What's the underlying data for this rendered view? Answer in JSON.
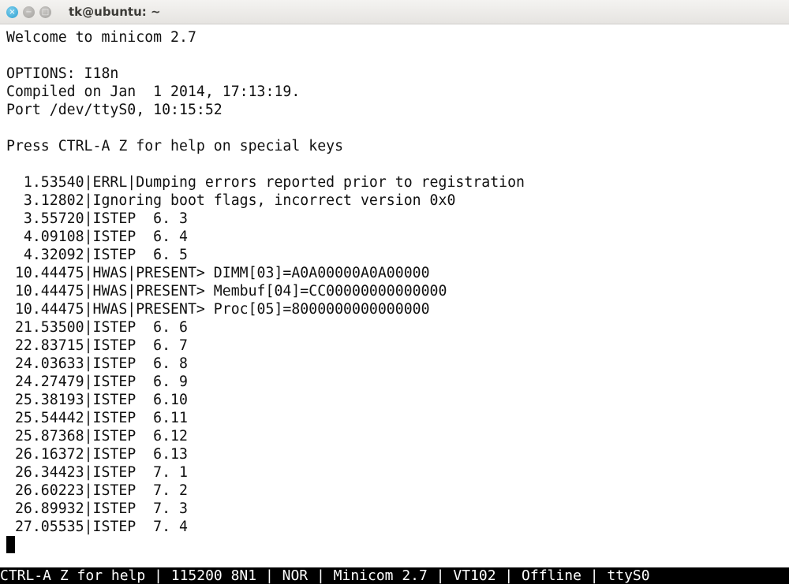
{
  "window": {
    "title": "tk@ubuntu: ~",
    "close_icon": "×",
    "minimize_icon": "−",
    "maximize_icon": "□"
  },
  "terminal": {
    "lines": [
      "Welcome to minicom 2.7",
      "",
      "OPTIONS: I18n",
      "Compiled on Jan  1 2014, 17:13:19.",
      "Port /dev/ttyS0, 10:15:52",
      "",
      "Press CTRL-A Z for help on special keys",
      "",
      "  1.53540|ERRL|Dumping errors reported prior to registration",
      "  3.12802|Ignoring boot flags, incorrect version 0x0",
      "  3.55720|ISTEP  6. 3",
      "  4.09108|ISTEP  6. 4",
      "  4.32092|ISTEP  6. 5",
      " 10.44475|HWAS|PRESENT> DIMM[03]=A0A00000A0A00000",
      " 10.44475|HWAS|PRESENT> Membuf[04]=CC00000000000000",
      " 10.44475|HWAS|PRESENT> Proc[05]=8000000000000000",
      " 21.53500|ISTEP  6. 6",
      " 22.83715|ISTEP  6. 7",
      " 24.03633|ISTEP  6. 8",
      " 24.27479|ISTEP  6. 9",
      " 25.38193|ISTEP  6.10",
      " 25.54442|ISTEP  6.11",
      " 25.87368|ISTEP  6.12",
      " 26.16372|ISTEP  6.13",
      " 26.34423|ISTEP  7. 1",
      " 26.60223|ISTEP  7. 2",
      " 26.89932|ISTEP  7. 3",
      " 27.05535|ISTEP  7. 4"
    ]
  },
  "status_bar": "CTRL-A Z for help | 115200 8N1 | NOR | Minicom 2.7 | VT102 | Offline | ttyS0"
}
